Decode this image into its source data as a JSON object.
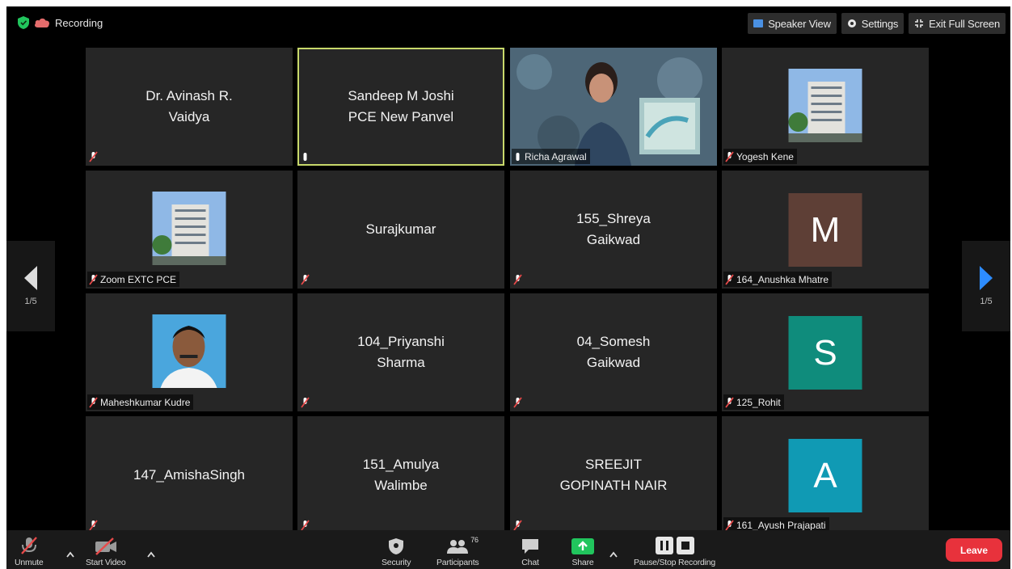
{
  "recording": {
    "label": "Recording"
  },
  "top_buttons": {
    "speaker_view": "Speaker View",
    "settings": "Settings",
    "exit_full_screen": "Exit Full Screen"
  },
  "pager": {
    "left": "1/5",
    "right": "1/5"
  },
  "participants": [
    {
      "display": "Dr. Avinash R.\nVaidya",
      "label": ""
    },
    {
      "display": "Sandeep M Joshi\nPCE New Panvel",
      "label": ""
    },
    {
      "display": "",
      "label": "Richa Agrawal"
    },
    {
      "display": "",
      "label": "Yogesh Kene"
    },
    {
      "display": "",
      "label": "Zoom EXTC PCE"
    },
    {
      "display": "Surajkumar",
      "label": ""
    },
    {
      "display": "155_Shreya\nGaikwad",
      "label": ""
    },
    {
      "display": "",
      "label": "164_Anushka Mhatre",
      "initial": "M"
    },
    {
      "display": "",
      "label": "Maheshkumar Kudre"
    },
    {
      "display": "104_Priyanshi\nSharma",
      "label": ""
    },
    {
      "display": "04_Somesh\nGaikwad",
      "label": ""
    },
    {
      "display": "",
      "label": "125_Rohit",
      "initial": "S"
    },
    {
      "display": "147_AmishaSingh",
      "label": ""
    },
    {
      "display": "151_Amulya\nWalimbe",
      "label": ""
    },
    {
      "display": "SREEJIT\nGOPINATH NAIR",
      "label": ""
    },
    {
      "display": "",
      "label": "161_Ayush Prajapati",
      "initial": "A"
    }
  ],
  "colors": {
    "avatar_m": "#5e3f36",
    "avatar_s": "#0f8c7c",
    "avatar_a": "#109ab4",
    "active_speaker": "#c8d96b",
    "leave": "#e8323c",
    "share": "#21c55d"
  },
  "toolbar": {
    "unmute": "Unmute",
    "start_video": "Start Video",
    "security": "Security",
    "participants": "Participants",
    "participants_count": "76",
    "chat": "Chat",
    "share": "Share",
    "pause_stop_recording": "Pause/Stop Recording",
    "leave": "Leave"
  }
}
